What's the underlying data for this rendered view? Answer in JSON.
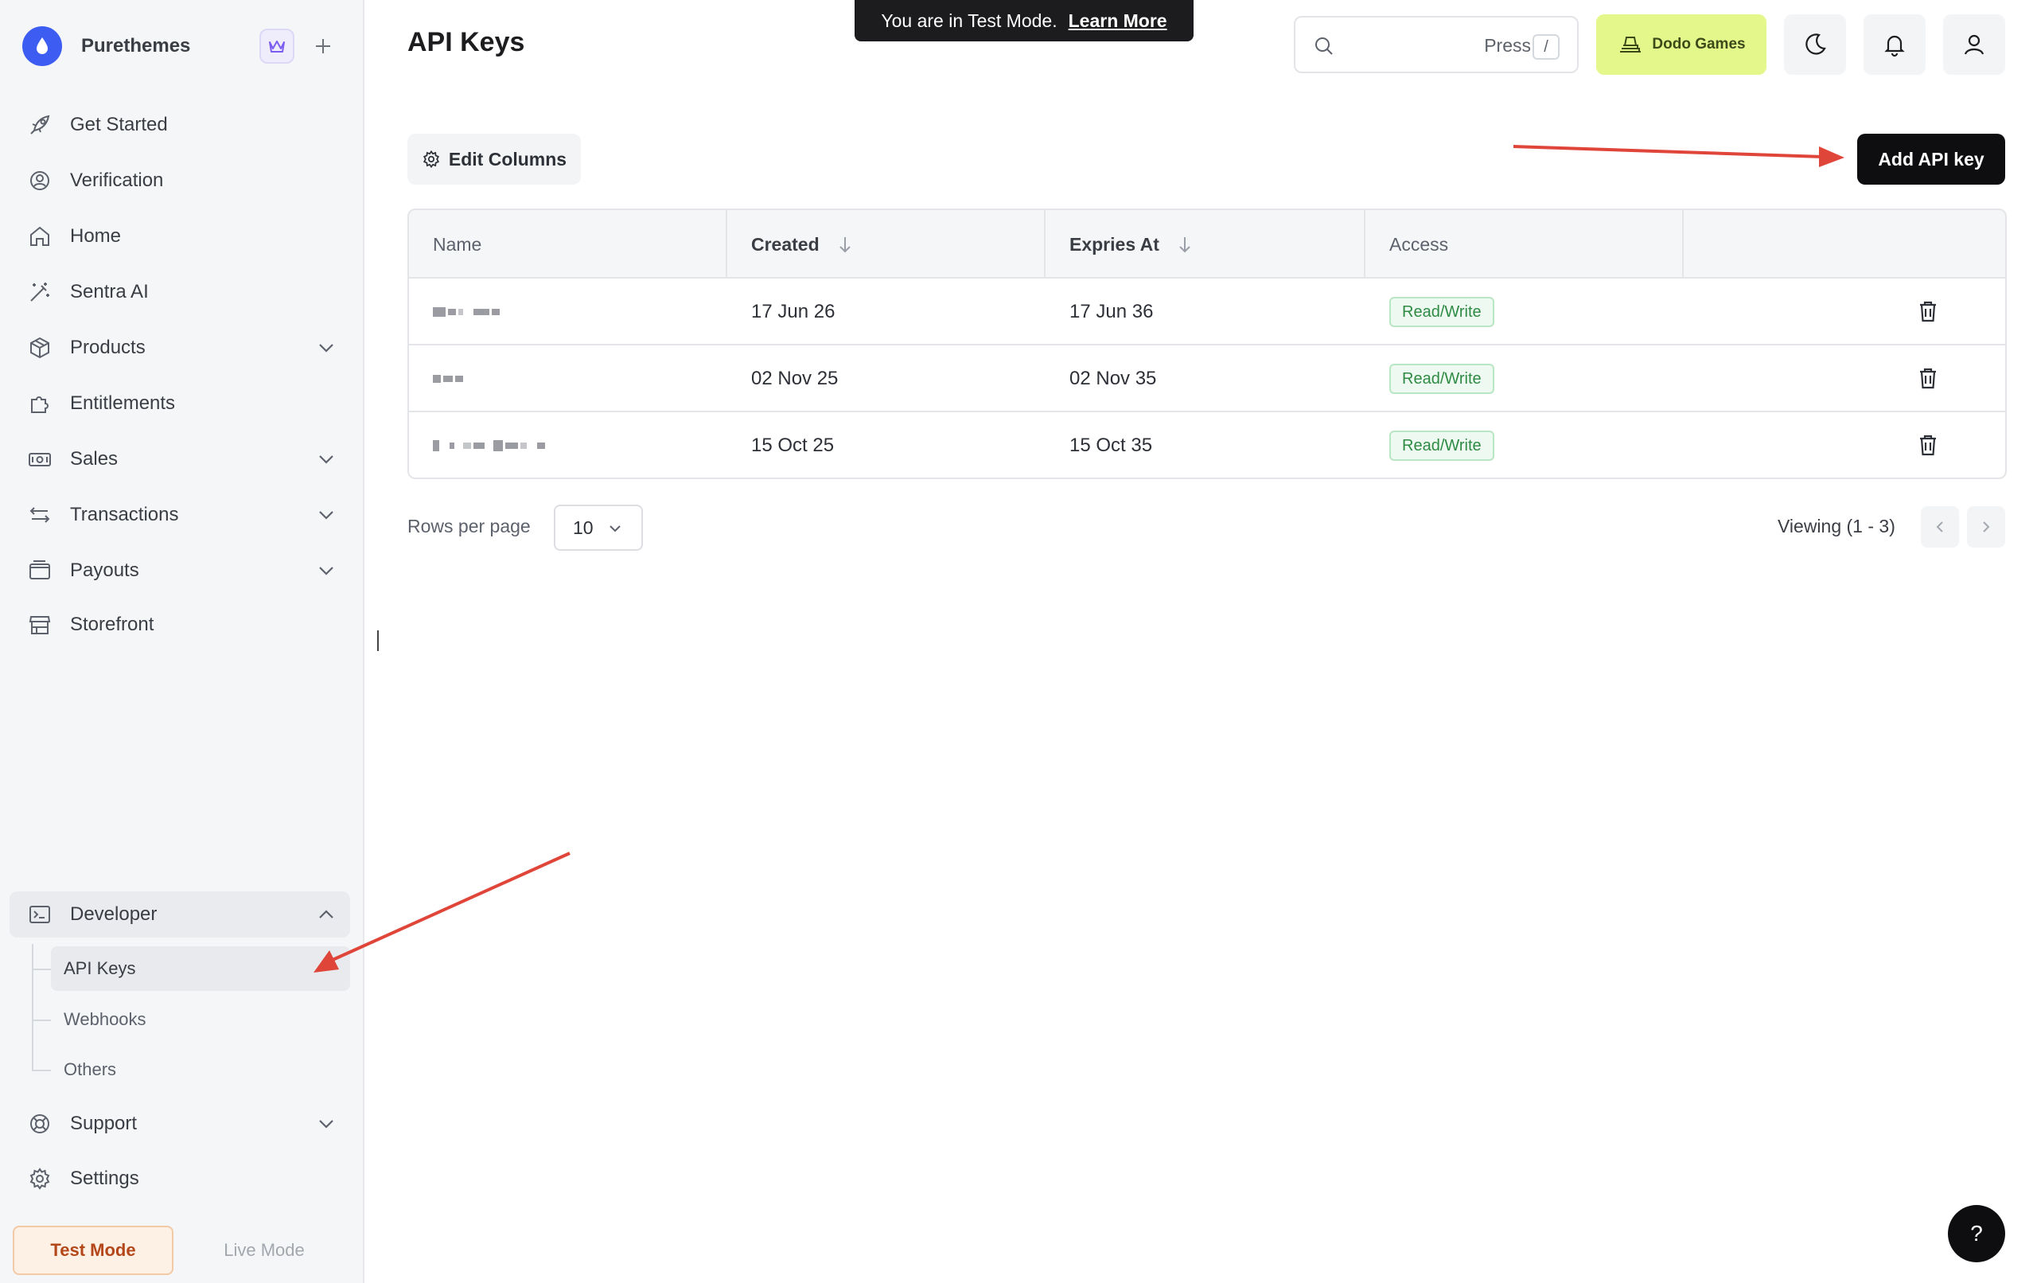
{
  "brand": {
    "name": "Purethemes"
  },
  "sidebar": {
    "items": [
      {
        "label": "Get Started",
        "icon": "rocket-icon"
      },
      {
        "label": "Verification",
        "icon": "verification-icon"
      },
      {
        "label": "Home",
        "icon": "home-icon"
      },
      {
        "label": "Sentra AI",
        "icon": "magic-wand-icon"
      },
      {
        "label": "Products",
        "icon": "box-icon",
        "expandable": true
      },
      {
        "label": "Entitlements",
        "icon": "puzzle-icon"
      },
      {
        "label": "Sales",
        "icon": "cash-icon",
        "expandable": true
      },
      {
        "label": "Transactions",
        "icon": "arrows-icon",
        "expandable": true
      },
      {
        "label": "Payouts",
        "icon": "wallet-icon",
        "expandable": true
      },
      {
        "label": "Storefront",
        "icon": "store-icon"
      }
    ],
    "developer": {
      "label": "Developer",
      "icon": "terminal-icon",
      "children": [
        "API Keys",
        "Webhooks",
        "Others"
      ],
      "active_child": "API Keys"
    },
    "support": {
      "label": "Support",
      "icon": "lifebuoy-icon"
    },
    "settings": {
      "label": "Settings",
      "icon": "gear-icon"
    },
    "modes": {
      "test": "Test Mode",
      "live": "Live Mode",
      "selected": "Test Mode"
    }
  },
  "header": {
    "title": "API Keys",
    "toast": {
      "text": "You are in Test Mode.",
      "link": "Learn More"
    },
    "search": {
      "hint": "Press",
      "shortcut": "/"
    },
    "business": "Dodo Games"
  },
  "toolbar": {
    "edit_columns": "Edit Columns",
    "add_key": "Add API key"
  },
  "table": {
    "columns": [
      "Name",
      "Created",
      "Expries At",
      "Access"
    ],
    "rows": [
      {
        "created": "17 Jun 26",
        "expires": "17 Jun 36",
        "access": "Read/Write"
      },
      {
        "created": "02 Nov 25",
        "expires": "02 Nov 35",
        "access": "Read/Write"
      },
      {
        "created": "15 Oct 25",
        "expires": "15 Oct 35",
        "access": "Read/Write"
      }
    ]
  },
  "pagination": {
    "rows_label": "Rows per page",
    "rows_value": "10",
    "viewing": "Viewing (1 - 3)"
  },
  "help": {
    "label": "?"
  },
  "colors": {
    "accent": "#3d5cf2",
    "business_bg": "#e4f78a",
    "annotation_arrow": "#e0453a",
    "badge_green": "#2f8a44"
  }
}
